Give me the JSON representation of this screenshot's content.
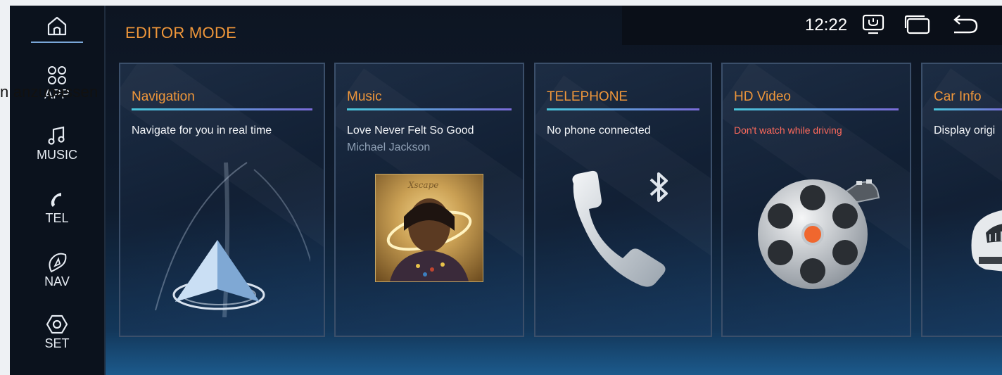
{
  "overlay": {
    "text": "n anzupassen"
  },
  "header": {
    "title": "EDITOR MODE",
    "clock": "12:22"
  },
  "sidebar": {
    "items": [
      {
        "label": ""
      },
      {
        "label": "APP"
      },
      {
        "label": "MUSIC"
      },
      {
        "label": "TEL"
      },
      {
        "label": "NAV"
      },
      {
        "label": "SET"
      }
    ]
  },
  "cards": [
    {
      "title": "Navigation",
      "subtitle": "Navigate for you in real time"
    },
    {
      "title": "Music",
      "subtitle": "Love Never Felt So Good",
      "artist": "Michael Jackson",
      "album_text": "Xscape"
    },
    {
      "title": "TELEPHONE",
      "subtitle": "No phone connected"
    },
    {
      "title": "HD Video",
      "warning": "Don't watch while driving"
    },
    {
      "title": "Car Info",
      "subtitle": "Display origi"
    }
  ],
  "colors": {
    "accent": "#f0973a",
    "warning": "#ff6a5c",
    "divider_start": "#48c4d8",
    "divider_end": "#7a6bd8"
  },
  "icons": [
    "home-icon",
    "app-grid-icon",
    "music-note-icon",
    "phone-icon",
    "nav-compass-icon",
    "settings-hexagon-icon",
    "screen-icon",
    "window-icon",
    "back-icon",
    "bluetooth-icon",
    "film-reel-icon"
  ]
}
